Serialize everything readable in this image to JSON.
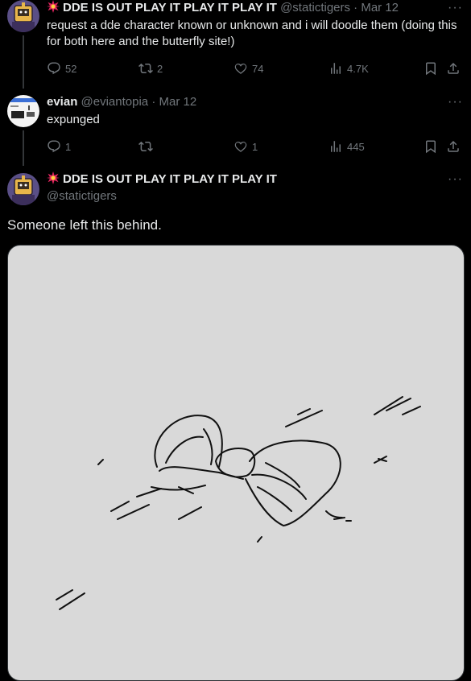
{
  "tweet1": {
    "display_name": "DDE IS OUT PLAY IT PLAY IT PLAY IT",
    "handle": "@statictigers",
    "separator": "·",
    "date": "Mar 12",
    "text": "request a dde character known or unknown and i will doodle them (doing this for both here and the butterfly site!)",
    "replies": "52",
    "reposts": "2",
    "likes": "74",
    "views": "4.7K",
    "more": "···"
  },
  "tweet2": {
    "display_name": "evian",
    "handle": "@eviantopia",
    "separator": "·",
    "date": "Mar 12",
    "text": "expunged",
    "replies": "1",
    "reposts": "",
    "likes": "1",
    "views": "445",
    "more": "···"
  },
  "tweet3": {
    "display_name": "DDE IS OUT PLAY IT PLAY IT PLAY IT",
    "handle": "@statictigers",
    "text": "Someone left this behind.",
    "more": "···"
  },
  "colors": {
    "background": "#000000",
    "text_primary": "#e7e9ea",
    "text_secondary": "#71767b",
    "divider": "#333639",
    "media_bg": "#d9d9d9",
    "spark_emoji": "#e0245e"
  }
}
